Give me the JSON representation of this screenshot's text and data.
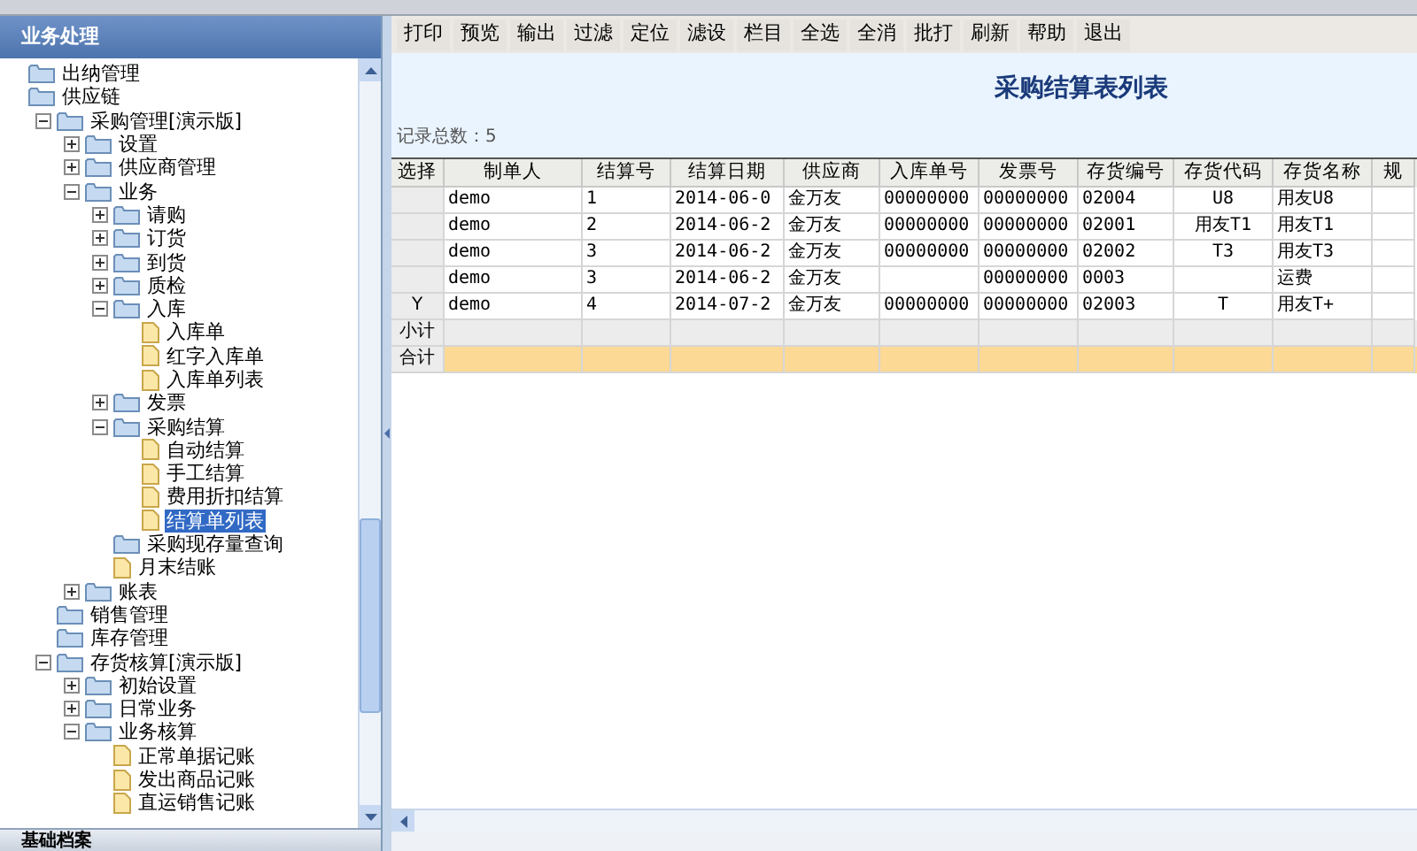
{
  "left_panel": {
    "title": "业务处理",
    "footer_title": "基础档案"
  },
  "tree": [
    {
      "label": "出纳管理",
      "kind": "folder",
      "selected": false
    },
    {
      "label": "供应链",
      "kind": "folder",
      "selected": false,
      "children": [
        {
          "label": "采购管理[演示版]",
          "kind": "folder",
          "expanded": true,
          "selected": false,
          "children": [
            {
              "label": "设置",
              "kind": "folder",
              "expanded": false,
              "selected": false
            },
            {
              "label": "供应商管理",
              "kind": "folder",
              "expanded": false,
              "selected": false
            },
            {
              "label": "业务",
              "kind": "folder",
              "expanded": true,
              "selected": false,
              "children": [
                {
                  "label": "请购",
                  "kind": "folder",
                  "expanded": false,
                  "selected": false
                },
                {
                  "label": "订货",
                  "kind": "folder",
                  "expanded": false,
                  "selected": false
                },
                {
                  "label": "到货",
                  "kind": "folder",
                  "expanded": false,
                  "selected": false
                },
                {
                  "label": "质检",
                  "kind": "folder",
                  "expanded": false,
                  "selected": false
                },
                {
                  "label": "入库",
                  "kind": "folder",
                  "expanded": true,
                  "selected": false,
                  "children": [
                    {
                      "label": "入库单",
                      "kind": "doc",
                      "selected": false
                    },
                    {
                      "label": "红字入库单",
                      "kind": "doc",
                      "selected": false
                    },
                    {
                      "label": "入库单列表",
                      "kind": "doc",
                      "selected": false
                    }
                  ]
                },
                {
                  "label": "发票",
                  "kind": "folder",
                  "expanded": false,
                  "selected": false
                },
                {
                  "label": "采购结算",
                  "kind": "folder",
                  "expanded": true,
                  "selected": false,
                  "children": [
                    {
                      "label": "自动结算",
                      "kind": "doc",
                      "selected": false
                    },
                    {
                      "label": "手工结算",
                      "kind": "doc",
                      "selected": false
                    },
                    {
                      "label": "费用折扣结算",
                      "kind": "doc",
                      "selected": false
                    },
                    {
                      "label": "结算单列表",
                      "kind": "doc",
                      "selected": true
                    }
                  ]
                },
                {
                  "label": "采购现存量查询",
                  "kind": "folder",
                  "selected": false
                },
                {
                  "label": "月末结账",
                  "kind": "doc",
                  "selected": false
                }
              ]
            },
            {
              "label": "账表",
              "kind": "folder",
              "expanded": false,
              "selected": false
            }
          ]
        },
        {
          "label": "销售管理",
          "kind": "folder",
          "selected": false
        },
        {
          "label": "库存管理",
          "kind": "folder",
          "selected": false
        },
        {
          "label": "存货核算[演示版]",
          "kind": "folder",
          "expanded": true,
          "selected": false,
          "children": [
            {
              "label": "初始设置",
              "kind": "folder",
              "expanded": false,
              "selected": false
            },
            {
              "label": "日常业务",
              "kind": "folder",
              "expanded": false,
              "selected": false
            },
            {
              "label": "业务核算",
              "kind": "folder",
              "expanded": true,
              "selected": false,
              "children": [
                {
                  "label": "正常单据记账",
                  "kind": "doc",
                  "selected": false
                },
                {
                  "label": "发出商品记账",
                  "kind": "doc",
                  "selected": false
                },
                {
                  "label": "直运销售记账",
                  "kind": "doc",
                  "selected": false
                }
              ]
            }
          ]
        }
      ]
    }
  ],
  "toolbar": [
    "打印",
    "预览",
    "输出",
    "过滤",
    "定位",
    "滤设",
    "栏目",
    "全选",
    "全消",
    "批打",
    "刷新",
    "帮助",
    "退出"
  ],
  "report": {
    "title": "采购结算表列表",
    "record_count": "记录总数：5"
  },
  "table": {
    "columns": [
      "选择",
      "制单人",
      "结算号",
      "结算日期",
      "供应商",
      "入库单号",
      "发票号",
      "存货编号",
      "存货代码",
      "存货名称",
      "规"
    ],
    "rows": [
      {
        "kind": "data",
        "cells": [
          "",
          "demo",
          "1",
          "2014-06-0",
          "金万友",
          "00000000",
          "00000000",
          "02004",
          "U8",
          "用友U8",
          ""
        ]
      },
      {
        "kind": "data",
        "cells": [
          "",
          "demo",
          "2",
          "2014-06-2",
          "金万友",
          "00000000",
          "00000000",
          "02001",
          "用友T1",
          "用友T1",
          ""
        ]
      },
      {
        "kind": "data",
        "cells": [
          "",
          "demo",
          "3",
          "2014-06-2",
          "金万友",
          "00000000",
          "00000000",
          "02002",
          "T3",
          "用友T3",
          ""
        ]
      },
      {
        "kind": "data",
        "cells": [
          "",
          "demo",
          "3",
          "2014-06-2",
          "金万友",
          "",
          "00000000",
          "0003",
          "",
          "运费",
          ""
        ]
      },
      {
        "kind": "data",
        "cells": [
          "Y",
          "demo",
          "4",
          "2014-07-2",
          "金万友",
          "00000000",
          "00000000",
          "02003",
          "T",
          "用友T+",
          ""
        ]
      },
      {
        "kind": "subtotal",
        "cells": [
          "小计",
          "",
          "",
          "",
          "",
          "",
          "",
          "",
          "",
          "",
          ""
        ]
      },
      {
        "kind": "total",
        "cells": [
          "合计",
          "",
          "",
          "",
          "",
          "",
          "",
          "",
          "",
          "",
          ""
        ]
      }
    ]
  }
}
